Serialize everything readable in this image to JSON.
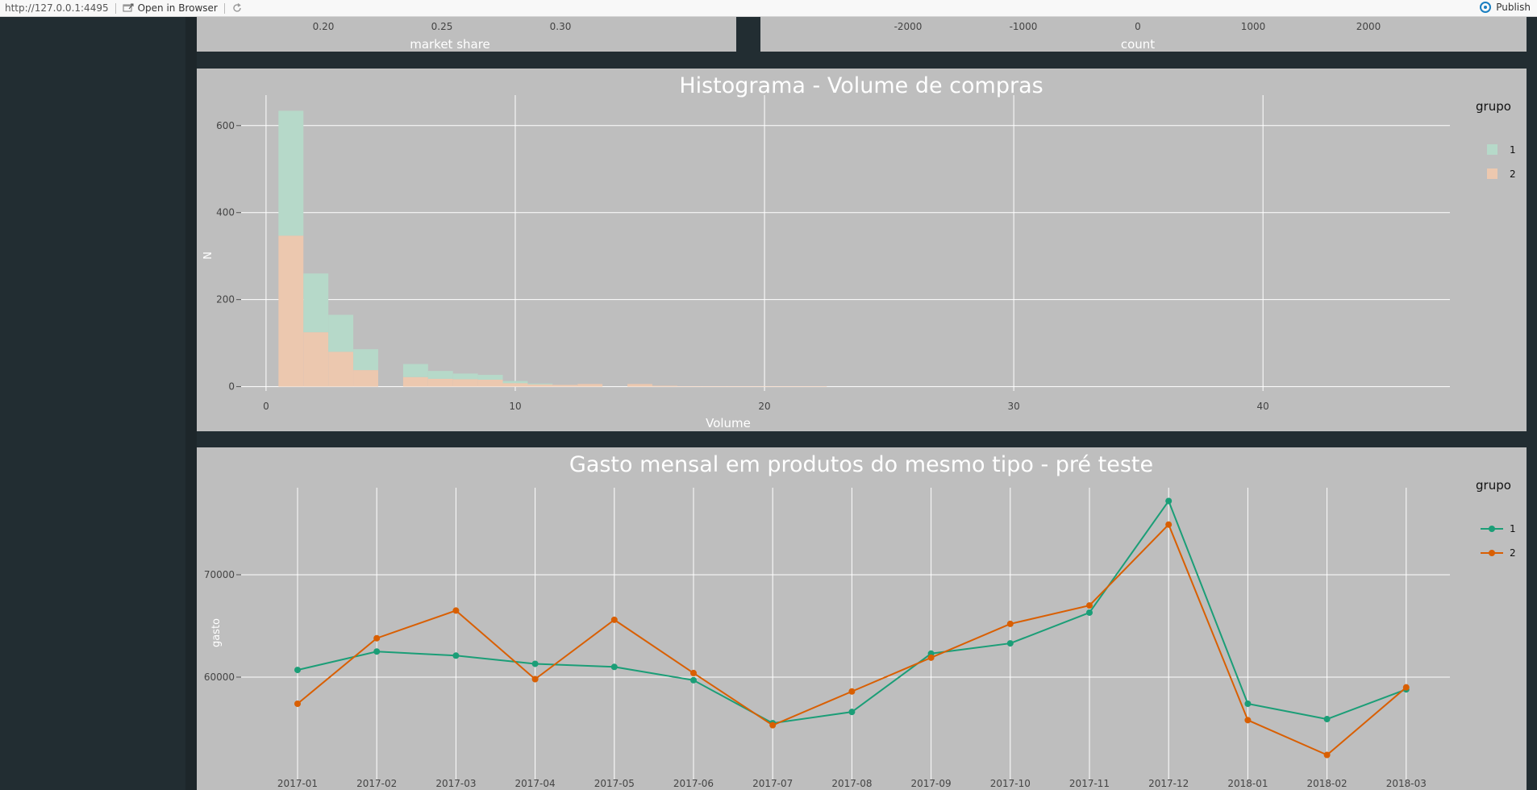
{
  "toolbar": {
    "url": "http://127.0.0.1:4495",
    "open_browser_label": "Open in Browser",
    "publish_label": "Publish"
  },
  "colors": {
    "background": "#222d32",
    "panel": "#bebebe",
    "group1": "#1b9e77",
    "group2": "#d95f02",
    "grid": "#ffffff"
  },
  "top_left_partial": {
    "xlabel": "market share",
    "ticks": [
      "0.20",
      "0.25",
      "0.30"
    ]
  },
  "top_right_partial": {
    "xlabel": "count",
    "ticks": [
      "-2000",
      "-1000",
      "0",
      "1000",
      "2000"
    ]
  },
  "chart_data": [
    {
      "type": "bar",
      "title": "Histograma - Volume de compras",
      "xlabel": "Volume",
      "ylabel": "N",
      "legend_title": "grupo",
      "legend_position": "right",
      "xlim": [
        -1,
        47.5
      ],
      "ylim": [
        -10,
        670
      ],
      "xticks": [
        0,
        10,
        20,
        30,
        40
      ],
      "yticks": [
        0,
        200,
        400,
        600
      ],
      "bin_centers": [
        1,
        2,
        3,
        4,
        5,
        6,
        7,
        8,
        9,
        10,
        11,
        12,
        13,
        14,
        15,
        16,
        17,
        18,
        19,
        20,
        21,
        22,
        23,
        24,
        25
      ],
      "series": [
        {
          "name": "1",
          "values": [
            287,
            135,
            85,
            48,
            0,
            30,
            18,
            13,
            11,
            5,
            2,
            0,
            0,
            0,
            0,
            0,
            0,
            0,
            0,
            0,
            0,
            0,
            0,
            0,
            0
          ]
        },
        {
          "name": "2",
          "values": [
            347,
            125,
            80,
            38,
            0,
            22,
            18,
            17,
            16,
            8,
            5,
            4,
            6,
            0,
            6,
            2,
            1,
            1,
            1,
            1,
            1,
            1,
            0,
            0,
            0
          ]
        }
      ],
      "grid": true
    },
    {
      "type": "line",
      "title": "Gasto mensal em produtos do mesmo tipo - pré teste",
      "xlabel": "",
      "ylabel": "gasto",
      "legend_title": "grupo",
      "legend_position": "right",
      "categories": [
        "2017-01",
        "2017-02",
        "2017-03",
        "2017-04",
        "2017-05",
        "2017-06",
        "2017-07",
        "2017-08",
        "2017-09",
        "2017-10",
        "2017-11",
        "2017-12",
        "2018-01",
        "2018-02",
        "2018-03"
      ],
      "yticks": [
        60000,
        70000
      ],
      "ylim": [
        50000,
        78500
      ],
      "series": [
        {
          "name": "1",
          "values": [
            60700,
            62500,
            62100,
            61300,
            61000,
            59700,
            55500,
            56600,
            62300,
            63300,
            66300,
            77200,
            57400,
            55900,
            58800
          ]
        },
        {
          "name": "2",
          "values": [
            57400,
            63800,
            66500,
            59800,
            65600,
            60400,
            55300,
            58600,
            61900,
            65200,
            67000,
            74900,
            55800,
            52400,
            59000
          ]
        }
      ],
      "grid": true
    }
  ]
}
